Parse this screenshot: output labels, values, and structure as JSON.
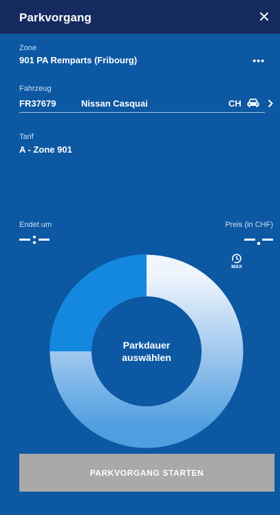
{
  "header": {
    "title": "Parkvorgang"
  },
  "zone": {
    "label": "Zone",
    "value": "901 PA Remparts (Fribourg)",
    "more": "•••"
  },
  "vehicle": {
    "label": "Fahrzeug",
    "plate": "FR37679",
    "model": "Nissan Casquai",
    "country": "CH"
  },
  "tariff": {
    "label": "Tarif",
    "value": "A - Zone 901"
  },
  "end": {
    "label": "Endet um"
  },
  "price": {
    "label": "Preis (in CHF)"
  },
  "max": {
    "label": "MAX"
  },
  "dial": {
    "text_line1": "Parkdauer",
    "text_line2": "auswählen"
  },
  "action": {
    "start_label": "PARKVORGANG STARTEN"
  },
  "colors": {
    "background": "#0d58a3",
    "header": "#152b60",
    "ring_active": "#1488de",
    "ring_light": "#eef5fc",
    "ring_gradient_end": "#4f9ee0",
    "button_disabled": "#a9a9a9"
  }
}
